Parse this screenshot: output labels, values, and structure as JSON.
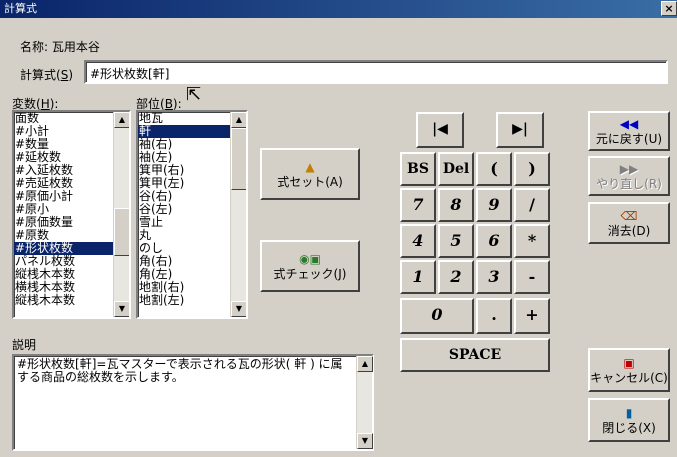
{
  "window": {
    "title": "計算式",
    "close": "×"
  },
  "name": {
    "label": "名称",
    "value": "瓦用本谷"
  },
  "formula": {
    "label": "計算式(",
    "key": "S",
    "label_end": ")",
    "value": "#形状枚数[軒]"
  },
  "variables": {
    "label": "変数(",
    "key": "H",
    "label_end": "):",
    "items": [
      "面数",
      "#小計",
      "#数量",
      "#延枚数",
      "#入延枚数",
      "#売延枚数",
      "#原価小計",
      "#原小",
      "#原価数量",
      "#原数",
      "#形状枚数",
      "パネル枚数",
      "縦桟木本数",
      "横桟木本数",
      "縦桟木本数"
    ],
    "selected_index": 10
  },
  "parts": {
    "label": "部位(",
    "key": "B",
    "label_end": "):",
    "items": [
      "地瓦",
      "軒",
      "袖(右)",
      "袖(左)",
      "箕甲(右)",
      "箕甲(左)",
      "谷(右)",
      "谷(左)",
      "雪止",
      "丸",
      "のし",
      "角(右)",
      "角(左)",
      "地割(右)",
      "地割(左)"
    ],
    "selected_index": 1
  },
  "buttons": {
    "set_formula": "式セット(A)",
    "check_formula": "式チェック(J)",
    "undo": "元に戻す(U)",
    "redo": "やり直し(R)",
    "erase": "消去(D)",
    "cancel": "キャンセル(C)",
    "close": "閉じる(X)"
  },
  "keypad": {
    "first": "|◀",
    "last": "▶|",
    "bs": "BS",
    "del": "Del",
    "lparen": "(",
    "rparen": ")",
    "k7": "7",
    "k8": "8",
    "k9": "9",
    "slash": "/",
    "k4": "4",
    "k5": "5",
    "k6": "6",
    "mul": "*",
    "k1": "1",
    "k2": "2",
    "k3": "3",
    "minus": "-",
    "k0": "0",
    "dot": ".",
    "plus": "+",
    "space": "SPACE"
  },
  "description": {
    "label": "説明",
    "text": "#形状枚数[軒]=瓦マスターで表示される瓦の形状( 軒 ) に属する商品の総枚数を示します。"
  },
  "colors": {
    "selection": "#0a246a",
    "face": "#d4d0c8"
  }
}
